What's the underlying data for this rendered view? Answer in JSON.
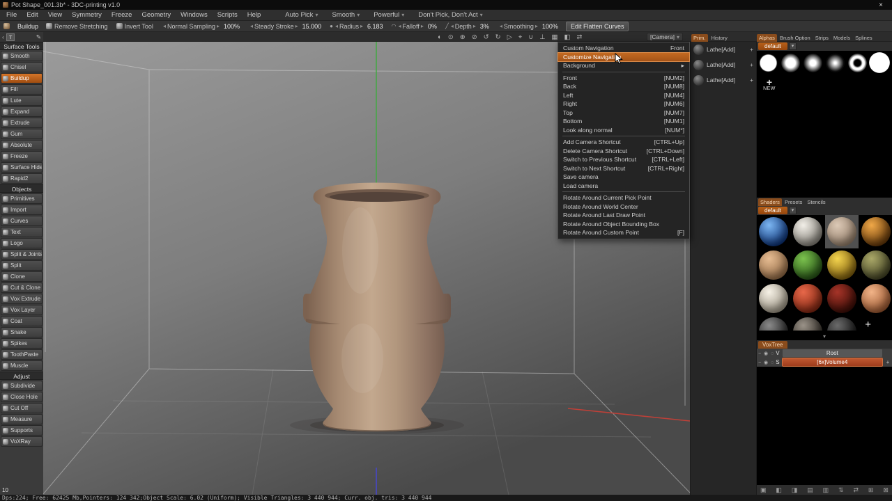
{
  "colors": {
    "accent_orange": "#c2661e",
    "menu_highlight": "#b55a1e",
    "voxtree_selected": "#b04a28",
    "pot_clay": "#ab8e76",
    "axis_green": "#43a843",
    "axis_red": "#bf4038",
    "axis_blue": "#4747c8"
  },
  "titlebar": {
    "title": "Pot Shape_001.3b* - 3DC-printing v1.0",
    "close_icon": "×"
  },
  "menubar": {
    "items": [
      "File",
      "Edit",
      "View",
      "Symmetry",
      "Freeze",
      "Geometry",
      "Windows",
      "Scripts",
      "Help"
    ],
    "modes": [
      {
        "label": "Auto Pick"
      },
      {
        "label": "Smooth"
      },
      {
        "label": "Powerful"
      },
      {
        "label": "Don't Pick, Don't Act"
      }
    ]
  },
  "icons": {
    "caret_down": "▾",
    "stepper_left": "◂",
    "stepper_right": "▸",
    "plus": "+",
    "pencil": "✎",
    "chevron_left": "‹",
    "tab_t": "T"
  },
  "toolbar": {
    "tool": {
      "label": "Buildup"
    },
    "toggles": [
      {
        "label": "Remove Stretching"
      },
      {
        "label": "Invert Tool"
      }
    ],
    "steppers": [
      {
        "label": "Normal Sampling",
        "value": "100%",
        "pre": ""
      },
      {
        "label": "Steady Stroke",
        "value": "15.000",
        "pre": ""
      },
      {
        "label": "Radius",
        "value": "6.183",
        "pre": "●"
      },
      {
        "label": "Falloff",
        "value": "0%",
        "pre": "◠"
      },
      {
        "label": "Depth",
        "value": "3%",
        "pre": "╱"
      },
      {
        "label": "Smoothing",
        "value": "100%",
        "pre": ""
      }
    ],
    "edit_flatten_label": "Edit Flatten Curves"
  },
  "subbar": {
    "view_icons": [
      {
        "glyph": "◐",
        "name": "shading-mode-icon"
      },
      {
        "glyph": "⊙",
        "name": "pivot-icon"
      },
      {
        "glyph": "⊕",
        "name": "add-view-icon"
      },
      {
        "glyph": "⊘",
        "name": "disable-icon"
      },
      {
        "glyph": "↺",
        "name": "rotate-left-icon"
      },
      {
        "glyph": "↻",
        "name": "rotate-right-icon"
      },
      {
        "glyph": "▷",
        "name": "play-icon"
      },
      {
        "glyph": "⌖",
        "name": "target-icon"
      },
      {
        "glyph": "∪",
        "name": "magnet-icon"
      },
      {
        "glyph": "⊥",
        "name": "normal-lock-icon"
      },
      {
        "glyph": "▦",
        "name": "grid-icon"
      },
      {
        "glyph": "◧",
        "name": "split-view-icon"
      },
      {
        "glyph": "⇄",
        "name": "swap-view-icon"
      }
    ],
    "camera_label": "[Camera]"
  },
  "camera_menu": {
    "items": [
      {
        "label": "Custom Navigation",
        "right": "Front"
      },
      {
        "label": "Customize Navigation",
        "cls": "active"
      },
      {
        "label": "Background",
        "right": "▸"
      },
      {
        "cls": "sep"
      },
      {
        "label": "Front",
        "right": "[NUM2]"
      },
      {
        "label": "Back",
        "right": "[NUM8]"
      },
      {
        "label": "Left",
        "right": "[NUM4]"
      },
      {
        "label": "Right",
        "right": "[NUM6]"
      },
      {
        "label": "Top",
        "right": "[NUM7]"
      },
      {
        "label": "Bottom",
        "right": "[NUM1]"
      },
      {
        "label": "Look along normal",
        "right": "[NUM*]"
      },
      {
        "cls": "sep"
      },
      {
        "label": "Add Camera Shortcut",
        "right": "[CTRL+Up]"
      },
      {
        "label": "Delete Camera Shortcut",
        "right": "[CTRL+Down]"
      },
      {
        "label": "Switch to Previous Shortcut",
        "right": "[CTRL+Left]"
      },
      {
        "label": "Switch to Next Shortcut",
        "right": "[CTRL+Right]"
      },
      {
        "label": "Save camera"
      },
      {
        "label": "Load camera"
      },
      {
        "cls": "sep"
      },
      {
        "label": "Rotate Around Current Pick Point"
      },
      {
        "label": "Rotate Around World Center"
      },
      {
        "label": "Rotate Around Last Draw Point"
      },
      {
        "label": "Rotate Around Object Bounding Box"
      },
      {
        "label": "Rotate Around Custom Point",
        "right": "[F]"
      }
    ]
  },
  "sidebar": {
    "sections": [
      {
        "title": "Surface Tools",
        "items": [
          {
            "label": "Smooth"
          },
          {
            "label": "Chisel"
          },
          {
            "label": "Buildup",
            "cls": "active"
          },
          {
            "label": "Fill"
          },
          {
            "label": "Lute"
          },
          {
            "label": "Expand"
          },
          {
            "label": "Extrude"
          },
          {
            "label": "Gum"
          },
          {
            "label": "Absolute"
          },
          {
            "label": "Freeze"
          },
          {
            "label": "Surface Hide"
          },
          {
            "label": "Rapid2"
          }
        ]
      },
      {
        "title": "Objects",
        "items": [
          {
            "label": "Primitives"
          },
          {
            "label": "Import"
          },
          {
            "label": "Curves"
          },
          {
            "label": "Text"
          },
          {
            "label": "Logo"
          },
          {
            "label": "Split & Joints"
          },
          {
            "label": "Split"
          },
          {
            "label": "Clone"
          },
          {
            "label": "Cut & Clone"
          },
          {
            "label": "Vox Extrude"
          },
          {
            "label": "Vox Layer"
          },
          {
            "label": "Coat"
          },
          {
            "label": "Snake"
          },
          {
            "label": "Spikes"
          },
          {
            "label": "ToothPaste"
          },
          {
            "label": "Muscle"
          }
        ]
      },
      {
        "title": "Adjust",
        "items": [
          {
            "label": "Subdivide"
          },
          {
            "label": "Close Hole"
          },
          {
            "label": "Cut Off"
          },
          {
            "label": "Measure"
          },
          {
            "label": "Supports"
          },
          {
            "label": "VoXRay"
          }
        ]
      }
    ]
  },
  "prim_panel": {
    "tabs": [
      {
        "label": "Prim.",
        "cls": "active"
      },
      {
        "label": "History"
      }
    ],
    "items": [
      {
        "label": "Lathe[Add]"
      },
      {
        "label": "Lathe[Add]"
      },
      {
        "label": "Lathe[Add]"
      }
    ]
  },
  "alpha_panel": {
    "tabs": [
      {
        "label": "Alphas",
        "cls": "active"
      },
      {
        "label": "Brush Option"
      },
      {
        "label": "Strips"
      },
      {
        "label": "Models"
      },
      {
        "label": "Splines"
      }
    ],
    "default_label": "default",
    "alphas": [
      {
        "name": "alpha-hard",
        "cls": "a1"
      },
      {
        "name": "alpha-medium",
        "cls": "a2"
      },
      {
        "name": "alpha-soft",
        "cls": "a3"
      },
      {
        "name": "alpha-softer",
        "cls": "a4"
      },
      {
        "name": "alpha-ring",
        "cls": "a5"
      },
      {
        "name": "alpha-flat",
        "cls": "a6"
      }
    ],
    "new_label": "NEW"
  },
  "shader_panel": {
    "tabs": [
      {
        "label": "Shaders",
        "cls": "active"
      },
      {
        "label": "Presets"
      },
      {
        "label": "Stencils"
      }
    ],
    "default_label": "default",
    "shaders": [
      {
        "name": "shader-blue-glossy",
        "colors": [
          "#7cb6f2",
          "#0a2f72"
        ]
      },
      {
        "name": "shader-pearl",
        "colors": [
          "#f2efe8",
          "#7e7a72"
        ]
      },
      {
        "name": "shader-clay",
        "colors": [
          "#dcc9b6",
          "#8f7a66"
        ],
        "cls": "selected"
      },
      {
        "name": "shader-bronze",
        "colors": [
          "#f0a848",
          "#5e3408"
        ]
      },
      {
        "name": "shader-tan",
        "colors": [
          "#e6bc92",
          "#8f6844"
        ]
      },
      {
        "name": "shader-green",
        "colors": [
          "#7cc24e",
          "#234e14"
        ]
      },
      {
        "name": "shader-gold",
        "colors": [
          "#f4d44e",
          "#7a5a0c"
        ]
      },
      {
        "name": "shader-olive",
        "colors": [
          "#aaa868",
          "#3f3f22"
        ]
      },
      {
        "name": "shader-ivory",
        "colors": [
          "#f6f1e6",
          "#968e7e"
        ]
      },
      {
        "name": "shader-coral",
        "colors": [
          "#e8684a",
          "#7c2410"
        ]
      },
      {
        "name": "shader-maroon",
        "colors": [
          "#a63428",
          "#380c06"
        ]
      },
      {
        "name": "shader-peach",
        "colors": [
          "#f2b488",
          "#96542e"
        ]
      }
    ],
    "partial_shaders": [
      {
        "name": "shader-dark-1",
        "colors": [
          "#8a8a8a",
          "#1a1a1a"
        ]
      },
      {
        "name": "shader-dark-2",
        "colors": [
          "#9a9288",
          "#2a2620"
        ]
      },
      {
        "name": "shader-dark-3",
        "colors": [
          "#6a6a6a",
          "#101010"
        ]
      }
    ]
  },
  "voxtree": {
    "tab_label": "VoxTree",
    "rows": [
      {
        "icons": "− ◉ ◌",
        "letter": "V",
        "label": "Root",
        "cls": "root"
      },
      {
        "icons": "− ◉ ◌",
        "letter": "S",
        "label": "[6x]Volume4",
        "cls": "selected",
        "plus": "+"
      }
    ]
  },
  "bottom_icons": [
    {
      "glyph": "▣",
      "name": "trash-icon"
    },
    {
      "glyph": "◧",
      "name": "folder-add-icon"
    },
    {
      "glyph": "◨",
      "name": "folder-icon"
    },
    {
      "glyph": "▤",
      "name": "layers-icon"
    },
    {
      "glyph": "▥",
      "name": "merge-icon"
    },
    {
      "glyph": "⇅",
      "name": "move-layer-icon"
    },
    {
      "glyph": "⇄",
      "name": "swap-icon"
    },
    {
      "glyph": "⊞",
      "name": "add-volume-icon"
    },
    {
      "glyph": "⊠",
      "name": "delete-volume-icon"
    }
  ],
  "statusbar": {
    "text": "Dps:224;  Free: 62425 Mb,Pointers: 124 342;Object Scale: 6.02 (Uniform); Visible Triangles: 3 440 944; Curr. obj. tris: 3 440 944"
  },
  "viewport": {
    "corner_label": "10"
  }
}
